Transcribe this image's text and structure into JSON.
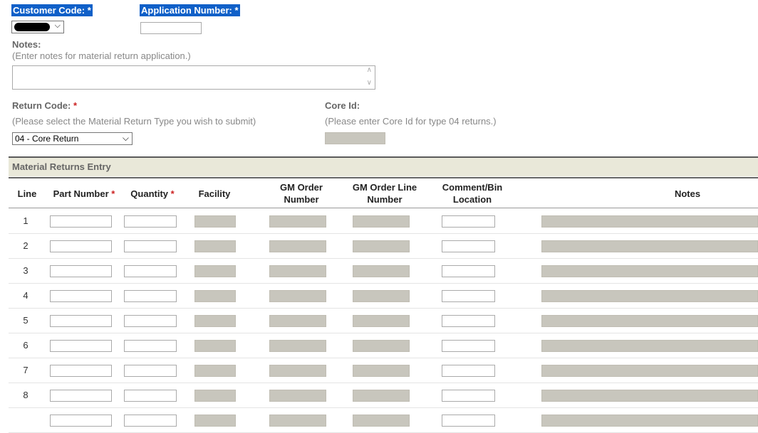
{
  "header": {
    "customer_code_label": "Customer Code:",
    "application_number_label": "Application Number:",
    "required_mark": "*"
  },
  "customer_select": {
    "value": ""
  },
  "application_number": {
    "value": ""
  },
  "notes": {
    "label": "Notes:",
    "hint": "(Enter notes for material return application.)",
    "value": ""
  },
  "return_code": {
    "label": "Return Code:",
    "hint": "(Please select the Material Return Type you wish to submit)",
    "selected": "04 - Core Return"
  },
  "core_id": {
    "label": "Core Id:",
    "hint": "(Please enter Core Id for type 04 returns.)"
  },
  "section_title": "Material Returns Entry",
  "table": {
    "columns": {
      "line": "Line",
      "part_number": "Part Number",
      "quantity": "Quantity",
      "facility": "Facility",
      "gm_order_number_1": "GM Order",
      "gm_order_number_2": "Number",
      "gm_order_line_1": "GM Order Line",
      "gm_order_line_2": "Number",
      "comment_bin_1": "Comment/Bin",
      "comment_bin_2": "Location",
      "notes": "Notes"
    },
    "rows": [
      "1",
      "2",
      "3",
      "4",
      "5",
      "6",
      "7",
      "8",
      ""
    ]
  }
}
